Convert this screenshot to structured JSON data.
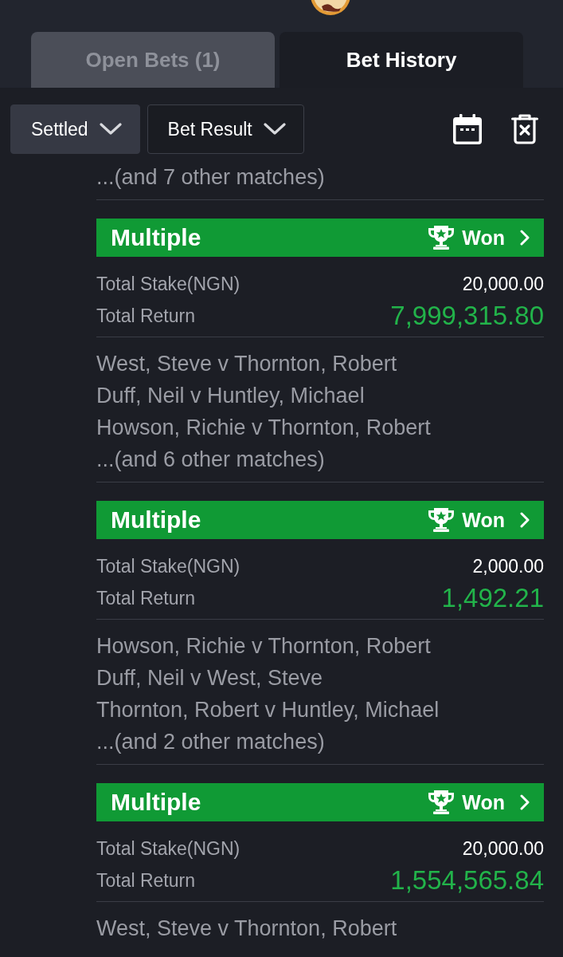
{
  "tabs": [
    {
      "label": "Open Bets (1)",
      "selected": false
    },
    {
      "label": "Bet History",
      "selected": true
    }
  ],
  "filters": [
    {
      "label": "Settled",
      "kind": "filled"
    },
    {
      "label": "Bet Result",
      "kind": "outlined"
    }
  ],
  "previous_bet": {
    "more_matches": "...(and 7 other matches)"
  },
  "bets": [
    {
      "type": "Multiple",
      "status": "Won",
      "stake_label": "Total Stake(NGN)",
      "stake": "20,000.00",
      "return_label": "Total Return",
      "return": "7,999,315.80",
      "matches": [
        "West, Steve v Thornton, Robert",
        "Duff, Neil v Huntley, Michael",
        "Howson, Richie v Thornton, Robert"
      ],
      "more_matches": "...(and 6 other matches)"
    },
    {
      "type": "Multiple",
      "status": "Won",
      "stake_label": "Total Stake(NGN)",
      "stake": "2,000.00",
      "return_label": "Total Return",
      "return": "1,492.21",
      "matches": [
        "Howson, Richie v Thornton, Robert",
        "Duff, Neil v West, Steve",
        "Thornton, Robert v Huntley, Michael"
      ],
      "more_matches": "...(and 2 other matches)"
    },
    {
      "type": "Multiple",
      "status": "Won",
      "stake_label": "Total Stake(NGN)",
      "stake": "20,000.00",
      "return_label": "Total Return",
      "return": "1,554,565.84",
      "matches": [
        "West, Steve v Thornton, Robert"
      ]
    }
  ]
}
